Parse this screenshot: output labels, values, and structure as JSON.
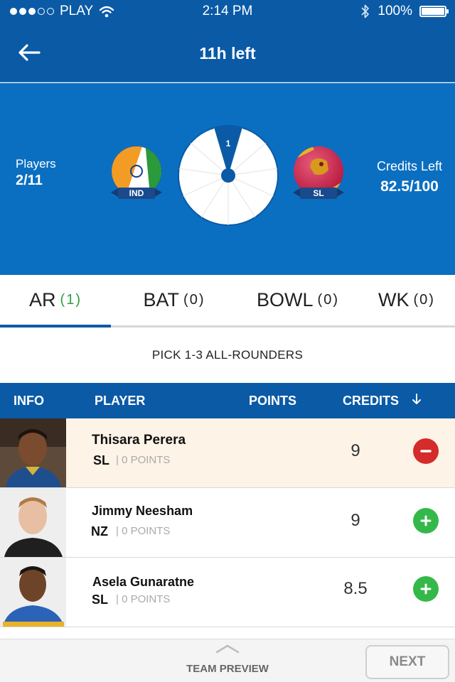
{
  "status_bar": {
    "carrier": "PLAY",
    "time": "2:14 PM",
    "battery": "100%",
    "battery_level": 1.0,
    "signal_bars_filled": 3,
    "signal_bars_total": 5
  },
  "header": {
    "title": "11h left",
    "back_icon": "arrow-left-icon"
  },
  "match": {
    "players_label": "Players",
    "players_value": "2/11",
    "team_left": {
      "code": "IND"
    },
    "team_right": {
      "code": "SL"
    },
    "wheel_label": "1",
    "credits_label": "Credits Left",
    "credits_value": "82.5/100"
  },
  "tabs": [
    {
      "label": "AR",
      "count": "(1)",
      "active": true
    },
    {
      "label": "BAT",
      "count": "(0)",
      "active": false
    },
    {
      "label": "BOWL",
      "count": "(0)",
      "active": false
    },
    {
      "label": "WK",
      "count": "(0)",
      "active": false
    }
  ],
  "pick_message": "PICK 1-3 ALL-ROUNDERS",
  "table_header": {
    "info": "INFO",
    "player": "PLAYER",
    "points": "POINTS",
    "credits": "CREDITS",
    "sort_icon": "arrow-down-icon"
  },
  "players": [
    {
      "name": "Thisara Perera",
      "team": "SL",
      "points": "| 0 POINTS",
      "credits": "9",
      "selected": true,
      "action": "remove"
    },
    {
      "name": "Jimmy Neesham",
      "team": "NZ",
      "points": "| 0 POINTS",
      "credits": "9",
      "selected": false,
      "action": "add"
    },
    {
      "name": "Asela Gunaratne",
      "team": "SL",
      "points": "| 0 POINTS",
      "credits": "8.5",
      "selected": false,
      "action": "add"
    }
  ],
  "footer": {
    "preview_label": "TEAM PREVIEW",
    "next_label": "NEXT"
  },
  "colors": {
    "primary_blue": "#0a5aa6",
    "match_blue": "#0b6fc1",
    "selected_row": "#fdf3e7",
    "add_green": "#35b84a",
    "remove_red": "#d42b2b",
    "count_green": "#2e9e3e"
  }
}
